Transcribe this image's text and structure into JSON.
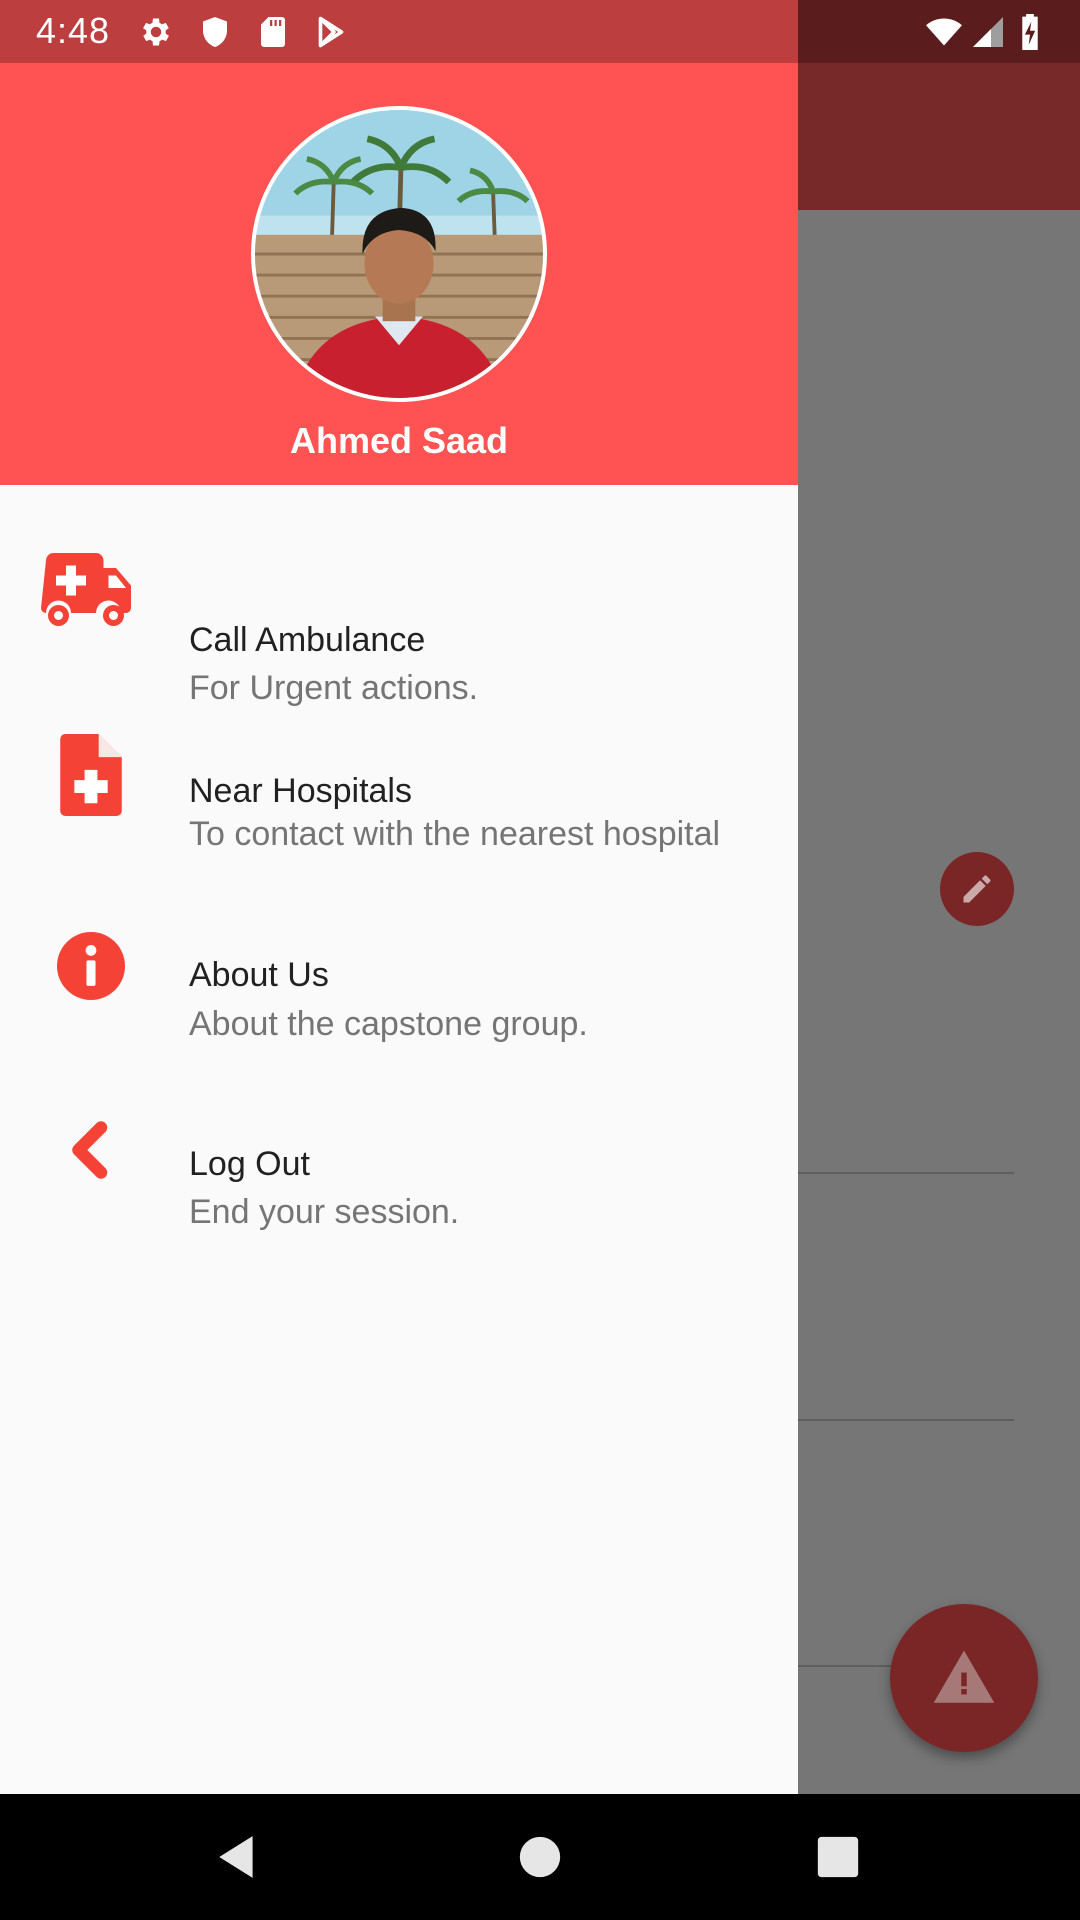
{
  "status_bar": {
    "time": "4:48",
    "left_icons": [
      "settings-icon",
      "shield-icon",
      "sd-card-icon",
      "play-store-icon"
    ],
    "right_icons": [
      "wifi-icon",
      "signal-icon",
      "battery-charging-icon"
    ]
  },
  "drawer": {
    "user_name": "Ahmed Saad",
    "items": [
      {
        "icon": "ambulance-icon",
        "title": "Call Ambulance",
        "subtitle": "For Urgent actions."
      },
      {
        "icon": "medical-file-icon",
        "title": "Near Hospitals",
        "subtitle": "To contact with the nearest hospital"
      },
      {
        "icon": "info-icon",
        "title": "About Us",
        "subtitle": "About the capstone group."
      },
      {
        "icon": "chevron-left-icon",
        "title": "Log Out",
        "subtitle": "End your session."
      }
    ]
  },
  "background_app": {
    "edit_button_icon": "pencil-icon",
    "alert_button_icon": "warning-icon"
  },
  "colors": {
    "accent": "#FF5252",
    "icon_red": "#F44336",
    "status_bar": "#BD3E3E",
    "drawer_bg": "#FAFAFA"
  },
  "nav_bar": {
    "buttons": [
      "back-icon",
      "home-icon",
      "recents-icon"
    ]
  }
}
